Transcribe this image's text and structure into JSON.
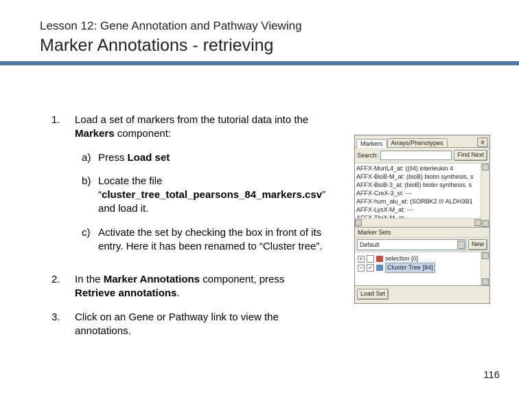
{
  "header": {
    "lesson_label": "Lesson 12: Gene Annotation and Pathway Viewing",
    "title": "Marker Annotations - retrieving"
  },
  "steps": {
    "n1": "1.",
    "n2": "2.",
    "n3": "3.",
    "s1_pre": "Load a set of markers from the tutorial data into the ",
    "s1_b": "Markers",
    "s1_post": " component:",
    "a_letter": "a)",
    "a_pre": "Press ",
    "a_b": "Load set",
    "b_letter": "b)",
    "b_pre": "Locate the file “",
    "b_b": "cluster_tree_total_pearsons_84_markers.csv",
    "b_post": "” and load it.",
    "c_letter": "c)",
    "c_text": "Activate the set by checking the box in front of its entry. Here it has been renamed to “Cluster tree”.",
    "s2_pre": "In the ",
    "s2_b1": "Marker Annotations",
    "s2_mid": " component, press ",
    "s2_b2": "Retrieve annotations",
    "s2_post": ".",
    "s3_text": "Click on an Gene or Pathway link to view the annotations."
  },
  "panel": {
    "tab_active": "Markers",
    "tab_other": "Arrays/Phenotypes",
    "close_glyph": "✕",
    "search_label": "Search:",
    "find_next": "Find Next",
    "markers": [
      "AFFX-MurIL4_at: ((Il4) interleukin 4",
      "AFFX-BioB-M_at: (bioB) biotin synthesis, s",
      "AFFX-BioB-3_at: (bioB) biotin synthesis, s",
      "AFFX-CreX-3_st: ---",
      "AFFX-hum_alu_at: (SORBK2 /// ALDH3B1",
      "AFFX-LysX-M_at: ---",
      "AFFX-ThrX-M_at: ---"
    ],
    "sets_header": "Marker Sets",
    "default_label": "Default",
    "new_btn": "New",
    "tree_expander1": "+",
    "tree_expander2": "−",
    "tree_item1": "selection [0]",
    "tree_item2": "Cluster Tree [84]",
    "tree_check2": "✓",
    "load_set_btn": "Load Set"
  },
  "page_number": "116"
}
